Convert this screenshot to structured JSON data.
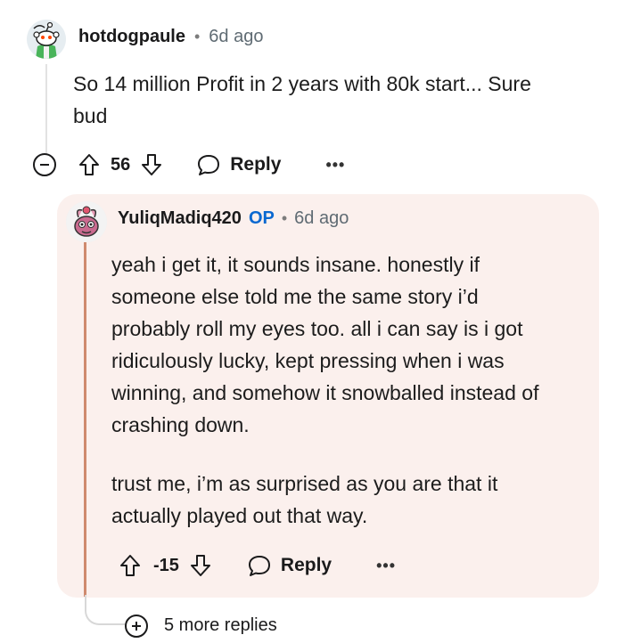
{
  "comment": {
    "username": "hotdogpaule",
    "separator": "•",
    "time": "6d ago",
    "body_line1": "So 14 million Profit in 2 years with 80k start... Sure",
    "body_line2": "bud",
    "score": "56",
    "reply_label": "Reply",
    "more_label": "•••",
    "avatar_icon": "reddit-snoo-avatar-icon"
  },
  "reply": {
    "username": "YuliqMadiq420",
    "op_badge": "OP",
    "separator": "•",
    "time": "6d ago",
    "paragraph1": [
      "yeah i get it, it sounds insane. honestly if",
      "someone else told me the same story i’d",
      "probably roll my eyes too. all i can say is i got",
      "ridiculously lucky, kept pressing when i was",
      "winning, and somehow it snowballed instead of",
      "crashing down."
    ],
    "paragraph2": [
      "trust me, i’m as surprised as you are that it",
      "actually played out that way."
    ],
    "score": "-15",
    "reply_label": "Reply",
    "more_label": "•••",
    "card_color": "#fbf0ed",
    "thread_color": "#cf8a6e"
  },
  "more_replies": {
    "label": "5 more replies"
  }
}
